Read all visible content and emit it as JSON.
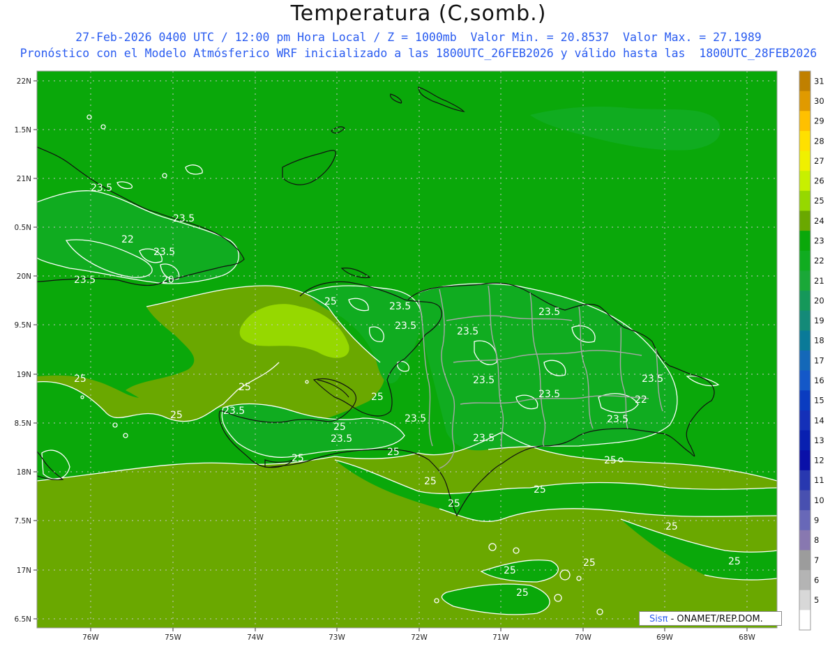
{
  "title": "Temperatura (C,somb.)",
  "subtitle1": "27-Feb-2026 0400 UTC / 12:00 pm Hora Local / Z = 1000mb  Valor Min. = 20.8537  Valor Max. = 27.1989",
  "subtitle2": "Pronóstico con el Modelo Atmósferico WRF inicializado a las 1800UTC_26FEB2026 y válido hasta las  1800UTC_28FEB2026",
  "credit": {
    "brand": "Sis",
    "pi": "π",
    "rest": " - ONAMET/REP.DOM."
  },
  "lat_labels": [
    "22N",
    "1.5N",
    "21N",
    "0.5N",
    "20N",
    "9.5N",
    "19N",
    "8.5N",
    "18N",
    "7.5N",
    "17N",
    "6.5N"
  ],
  "lon_labels": [
    "76W",
    "75W",
    "74W",
    "73W",
    "72W",
    "71W",
    "70W",
    "69W",
    "68W"
  ],
  "contour_labels": [
    "23.5",
    "23.5",
    "22",
    "23.5",
    "23.5",
    "20",
    "25",
    "23.5",
    "23.5",
    "23.5",
    "23.5",
    "23.5",
    "23.5",
    "23.5",
    "22",
    "23.5",
    "25",
    "25",
    "23.5",
    "25",
    "23.5",
    "25",
    "25",
    "25",
    "23.5",
    "25",
    "25",
    "25",
    "25",
    "25",
    "25",
    "25",
    "25"
  ],
  "colorbar": {
    "labels": [
      "31",
      "30",
      "29",
      "28",
      "27",
      "26",
      "25",
      "24",
      "23",
      "22",
      "21",
      "20",
      "19",
      "18",
      "17",
      "16",
      "15",
      "14",
      "13",
      "12",
      "11",
      "10",
      "9",
      "8",
      "7",
      "6",
      "5"
    ],
    "colors": [
      "#c08000",
      "#e09a00",
      "#ffc000",
      "#ffe000",
      "#f0f000",
      "#c8f000",
      "#96d800",
      "#6aa800",
      "#0aa80a",
      "#10ac20",
      "#1aa838",
      "#15985a",
      "#148a78",
      "#0a7a98",
      "#1468b8",
      "#1458c8",
      "#0a3cc0",
      "#1430b8",
      "#0820b0",
      "#0a10a8",
      "#2838b0",
      "#4850b0",
      "#6868b8",
      "#8878b0",
      "#9c9c9c",
      "#b4b4b4",
      "#d8d8d8",
      "#ffffff"
    ]
  }
}
